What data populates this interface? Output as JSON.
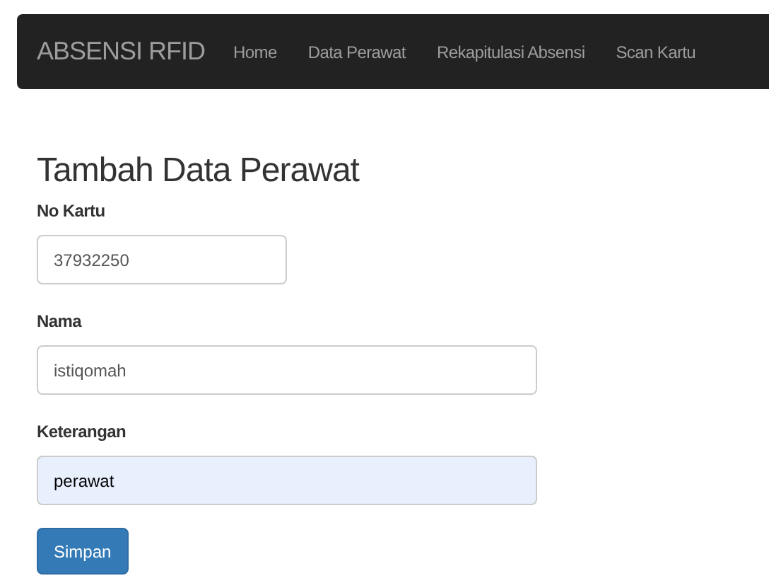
{
  "navbar": {
    "brand": "ABSENSI RFID",
    "links": [
      {
        "label": "Home"
      },
      {
        "label": "Data Perawat"
      },
      {
        "label": "Rekapitulasi Absensi"
      },
      {
        "label": "Scan Kartu"
      }
    ]
  },
  "form": {
    "title": "Tambah Data Perawat",
    "fields": [
      {
        "label": "No Kartu",
        "value": "37932250",
        "kind": "short",
        "autofilled": false
      },
      {
        "label": "Nama",
        "value": "istiqomah",
        "kind": "wide",
        "autofilled": false
      },
      {
        "label": "Keterangan",
        "value": "perawat",
        "kind": "wide",
        "autofilled": true
      }
    ],
    "submit": "Simpan"
  }
}
